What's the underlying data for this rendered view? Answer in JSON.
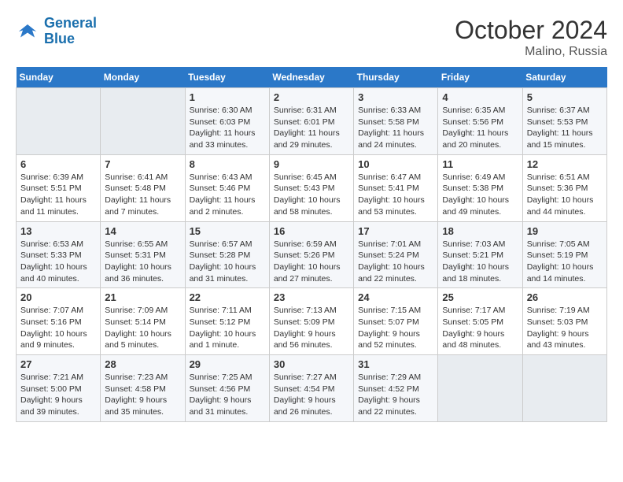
{
  "header": {
    "logo_line1": "General",
    "logo_line2": "Blue",
    "month": "October 2024",
    "location": "Malino, Russia"
  },
  "weekdays": [
    "Sunday",
    "Monday",
    "Tuesday",
    "Wednesday",
    "Thursday",
    "Friday",
    "Saturday"
  ],
  "weeks": [
    [
      {
        "day": "",
        "info": ""
      },
      {
        "day": "",
        "info": ""
      },
      {
        "day": "1",
        "info": "Sunrise: 6:30 AM\nSunset: 6:03 PM\nDaylight: 11 hours and 33 minutes."
      },
      {
        "day": "2",
        "info": "Sunrise: 6:31 AM\nSunset: 6:01 PM\nDaylight: 11 hours and 29 minutes."
      },
      {
        "day": "3",
        "info": "Sunrise: 6:33 AM\nSunset: 5:58 PM\nDaylight: 11 hours and 24 minutes."
      },
      {
        "day": "4",
        "info": "Sunrise: 6:35 AM\nSunset: 5:56 PM\nDaylight: 11 hours and 20 minutes."
      },
      {
        "day": "5",
        "info": "Sunrise: 6:37 AM\nSunset: 5:53 PM\nDaylight: 11 hours and 15 minutes."
      }
    ],
    [
      {
        "day": "6",
        "info": "Sunrise: 6:39 AM\nSunset: 5:51 PM\nDaylight: 11 hours and 11 minutes."
      },
      {
        "day": "7",
        "info": "Sunrise: 6:41 AM\nSunset: 5:48 PM\nDaylight: 11 hours and 7 minutes."
      },
      {
        "day": "8",
        "info": "Sunrise: 6:43 AM\nSunset: 5:46 PM\nDaylight: 11 hours and 2 minutes."
      },
      {
        "day": "9",
        "info": "Sunrise: 6:45 AM\nSunset: 5:43 PM\nDaylight: 10 hours and 58 minutes."
      },
      {
        "day": "10",
        "info": "Sunrise: 6:47 AM\nSunset: 5:41 PM\nDaylight: 10 hours and 53 minutes."
      },
      {
        "day": "11",
        "info": "Sunrise: 6:49 AM\nSunset: 5:38 PM\nDaylight: 10 hours and 49 minutes."
      },
      {
        "day": "12",
        "info": "Sunrise: 6:51 AM\nSunset: 5:36 PM\nDaylight: 10 hours and 44 minutes."
      }
    ],
    [
      {
        "day": "13",
        "info": "Sunrise: 6:53 AM\nSunset: 5:33 PM\nDaylight: 10 hours and 40 minutes."
      },
      {
        "day": "14",
        "info": "Sunrise: 6:55 AM\nSunset: 5:31 PM\nDaylight: 10 hours and 36 minutes."
      },
      {
        "day": "15",
        "info": "Sunrise: 6:57 AM\nSunset: 5:28 PM\nDaylight: 10 hours and 31 minutes."
      },
      {
        "day": "16",
        "info": "Sunrise: 6:59 AM\nSunset: 5:26 PM\nDaylight: 10 hours and 27 minutes."
      },
      {
        "day": "17",
        "info": "Sunrise: 7:01 AM\nSunset: 5:24 PM\nDaylight: 10 hours and 22 minutes."
      },
      {
        "day": "18",
        "info": "Sunrise: 7:03 AM\nSunset: 5:21 PM\nDaylight: 10 hours and 18 minutes."
      },
      {
        "day": "19",
        "info": "Sunrise: 7:05 AM\nSunset: 5:19 PM\nDaylight: 10 hours and 14 minutes."
      }
    ],
    [
      {
        "day": "20",
        "info": "Sunrise: 7:07 AM\nSunset: 5:16 PM\nDaylight: 10 hours and 9 minutes."
      },
      {
        "day": "21",
        "info": "Sunrise: 7:09 AM\nSunset: 5:14 PM\nDaylight: 10 hours and 5 minutes."
      },
      {
        "day": "22",
        "info": "Sunrise: 7:11 AM\nSunset: 5:12 PM\nDaylight: 10 hours and 1 minute."
      },
      {
        "day": "23",
        "info": "Sunrise: 7:13 AM\nSunset: 5:09 PM\nDaylight: 9 hours and 56 minutes."
      },
      {
        "day": "24",
        "info": "Sunrise: 7:15 AM\nSunset: 5:07 PM\nDaylight: 9 hours and 52 minutes."
      },
      {
        "day": "25",
        "info": "Sunrise: 7:17 AM\nSunset: 5:05 PM\nDaylight: 9 hours and 48 minutes."
      },
      {
        "day": "26",
        "info": "Sunrise: 7:19 AM\nSunset: 5:03 PM\nDaylight: 9 hours and 43 minutes."
      }
    ],
    [
      {
        "day": "27",
        "info": "Sunrise: 7:21 AM\nSunset: 5:00 PM\nDaylight: 9 hours and 39 minutes."
      },
      {
        "day": "28",
        "info": "Sunrise: 7:23 AM\nSunset: 4:58 PM\nDaylight: 9 hours and 35 minutes."
      },
      {
        "day": "29",
        "info": "Sunrise: 7:25 AM\nSunset: 4:56 PM\nDaylight: 9 hours and 31 minutes."
      },
      {
        "day": "30",
        "info": "Sunrise: 7:27 AM\nSunset: 4:54 PM\nDaylight: 9 hours and 26 minutes."
      },
      {
        "day": "31",
        "info": "Sunrise: 7:29 AM\nSunset: 4:52 PM\nDaylight: 9 hours and 22 minutes."
      },
      {
        "day": "",
        "info": ""
      },
      {
        "day": "",
        "info": ""
      }
    ]
  ]
}
